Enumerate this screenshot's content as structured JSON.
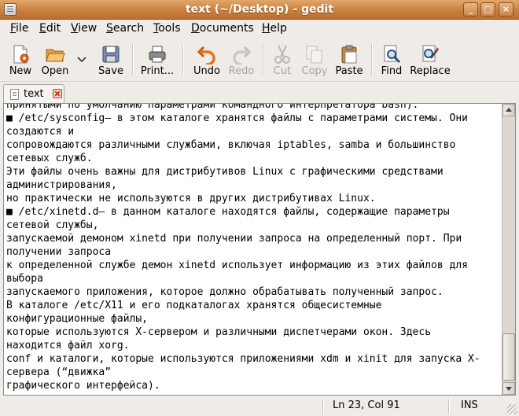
{
  "window": {
    "title": "text (~/Desktop) - gedit"
  },
  "menu": [
    {
      "key": "F",
      "rest": "ile"
    },
    {
      "key": "E",
      "rest": "dit"
    },
    {
      "key": "V",
      "rest": "iew"
    },
    {
      "key": "S",
      "rest": "earch"
    },
    {
      "key": "T",
      "rest": "ools"
    },
    {
      "key": "D",
      "rest": "ocuments"
    },
    {
      "key": "H",
      "rest": "elp"
    }
  ],
  "toolbar": {
    "new": "New",
    "open": "Open",
    "save": "Save",
    "print": "Print...",
    "undo": "Undo",
    "redo": "Redo",
    "cut": "Cut",
    "copy": "Copy",
    "paste": "Paste",
    "find": "Find",
    "replace": "Replace"
  },
  "tab": {
    "label": "text"
  },
  "editor": {
    "lines": [
      "принятыми по умолчанию параметрами командного интерпретатора bash).",
      "■ /etc/sysconfig— в этом каталоге хранятся файлы с параметрами системы. Они",
      "создаются и",
      "сопровождаются различными службами, включая iptables, samba и большинство",
      "сетевых служб.",
      "Эти файлы очень важны для дистрибутивов Linux с графическими средствами",
      "администрирования,",
      "но практически не используются в других дистрибутивах Linux.",
      "■ /etc/xinetd.d— в данном каталоге находятся файлы, содержащие параметры",
      "сетевой службы,",
      "запускаемой демоном xinetd при получении запроса на определенный порт. При",
      "получении запроса",
      "к определенной службе демон xinetd использует информацию из этих файлов для",
      "выбора",
      "запускаемого приложения, которое должно обрабатывать полученный запрос.",
      "В каталоге /etc/X11 и его подкаталогах хранятся общесистемные",
      "конфигурационные файлы,",
      "которые используются X-сервером и различными диспетчерами окон. Здесь",
      "находится файл xorg.",
      "conf и каталоги, которые используются приложениями xdm и xinit для запуска X-",
      "сервера (“движка”",
      "графического интерфейса)."
    ]
  },
  "status": {
    "position": "Ln 23, Col 91",
    "mode": "INS"
  }
}
